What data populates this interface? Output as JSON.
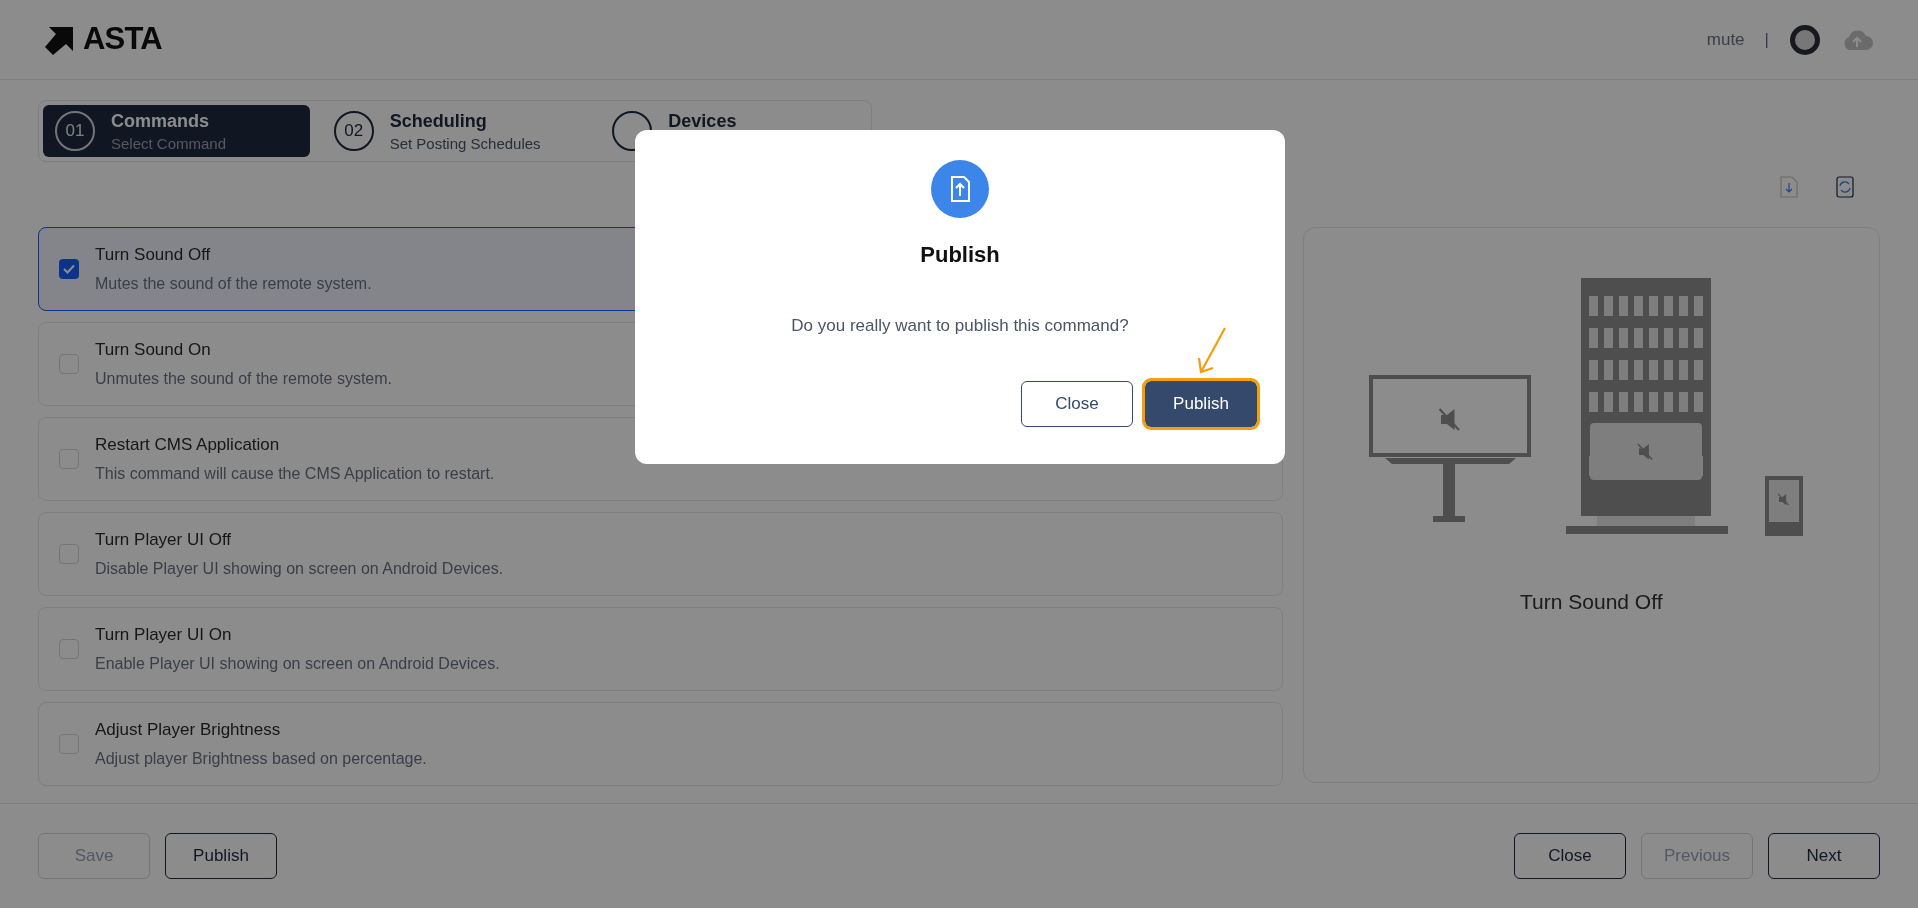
{
  "header": {
    "logo": "ASTA",
    "user_label": "mute",
    "separator": "|"
  },
  "stepper": [
    {
      "number": "01",
      "title": "Commands",
      "subtitle": "Select Command",
      "selected": true
    },
    {
      "number": "02",
      "title": "Scheduling",
      "subtitle": "Set Posting Schedules",
      "selected": false
    },
    {
      "title": "Devices",
      "selected": false
    }
  ],
  "commands": [
    {
      "title": "Turn Sound Off",
      "description": "Mutes the sound of the remote system.",
      "checked": true
    },
    {
      "title": "Turn Sound On",
      "description": "Unmutes the sound of the remote system.",
      "checked": false
    },
    {
      "title": "Restart CMS Application",
      "description": "This command will cause the CMS Application to restart.",
      "checked": false
    },
    {
      "title": "Turn Player UI Off",
      "description": "Disable Player UI showing on screen on Android Devices.",
      "checked": false
    },
    {
      "title": "Turn Player UI On",
      "description": "Enable Player UI showing on screen on Android Devices.",
      "checked": false
    },
    {
      "title": "Adjust Player Brightness",
      "description": "Adjust player Brightness based on percentage.",
      "checked": false
    }
  ],
  "preview": {
    "caption": "Turn Sound Off"
  },
  "footer": {
    "left_buttons": [
      {
        "label": "Save",
        "disabled": true
      },
      {
        "label": "Publish",
        "disabled": false
      }
    ],
    "right_buttons": [
      {
        "label": "Close",
        "disabled": false
      },
      {
        "label": "Previous",
        "disabled": true
      },
      {
        "label": "Next",
        "disabled": false
      }
    ]
  },
  "dialog": {
    "title": "Publish",
    "message": "Do you really want to publish this command?",
    "buttons": [
      {
        "label": "Close",
        "kind": "secondary",
        "focused": false
      },
      {
        "label": "Publish",
        "kind": "primary",
        "focused": true
      }
    ]
  }
}
